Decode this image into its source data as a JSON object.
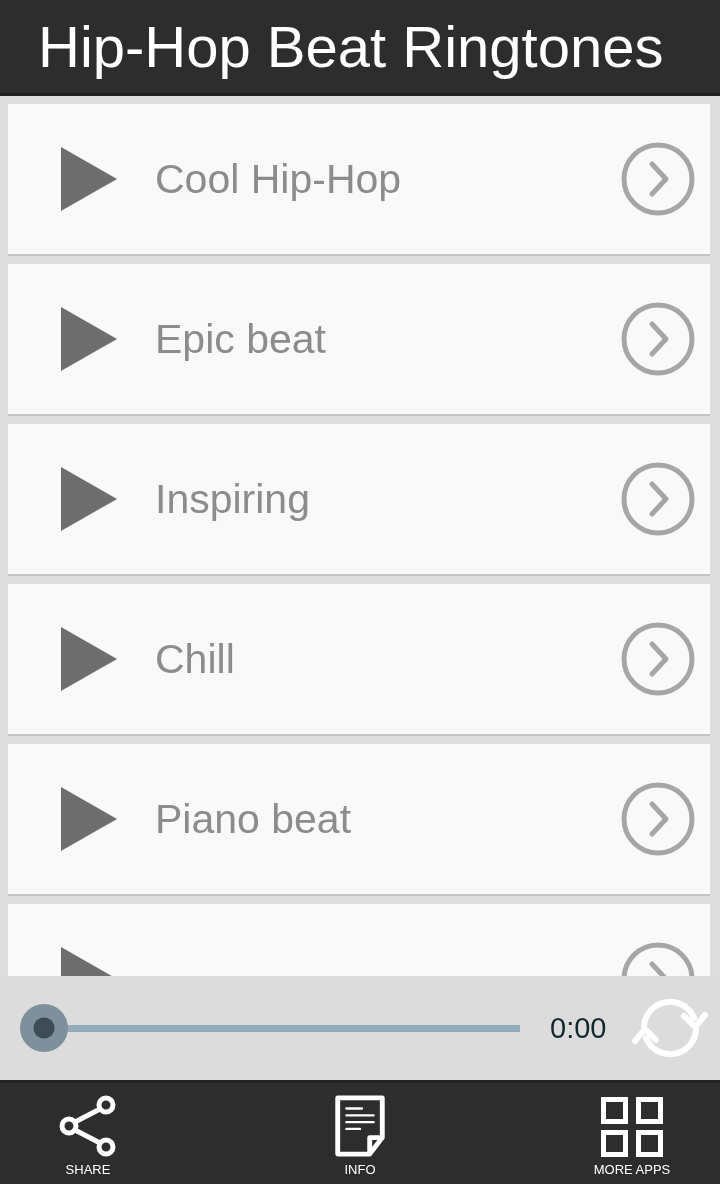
{
  "app_bar": {
    "title": "Hip-Hop Beat Ringtones"
  },
  "ringtones": [
    {
      "kind": "full",
      "name": "Cool Hip-Hop"
    },
    {
      "kind": "full",
      "name": "Epic beat"
    },
    {
      "kind": "full",
      "name": "Inspiring"
    },
    {
      "kind": "full",
      "name": "Chill"
    },
    {
      "kind": "full",
      "name": "Piano beat"
    },
    {
      "kind": "cut_off"
    }
  ],
  "player": {
    "level": 0,
    "time": "0:00"
  },
  "bottom_nav": [
    {
      "kind": "share",
      "label": "SHARE"
    },
    {
      "kind": "info",
      "label": "INFO"
    },
    {
      "kind": "apps",
      "label": "MORE APPS"
    }
  ]
}
